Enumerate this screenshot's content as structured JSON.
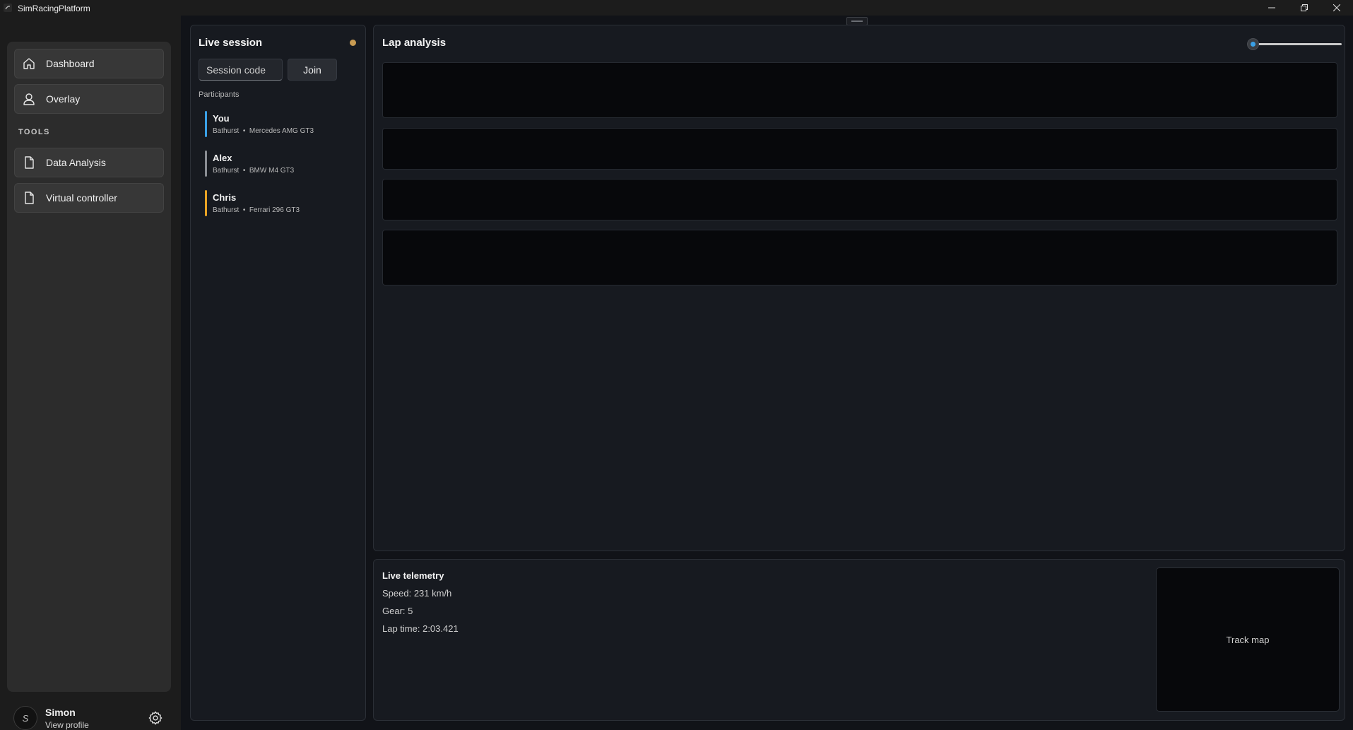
{
  "window": {
    "title": "SimRacingPlatform",
    "controls": [
      "minimize",
      "maximize",
      "close"
    ]
  },
  "sidebar": {
    "items": [
      {
        "label": "Dashboard",
        "icon": "home-icon"
      },
      {
        "label": "Overlay",
        "icon": "person-icon"
      }
    ],
    "section_title": "TOOLS",
    "tools": [
      {
        "label": "Data Analysis",
        "icon": "document-icon"
      },
      {
        "label": "Virtual controller",
        "icon": "document-icon"
      }
    ],
    "profile": {
      "initial": "S",
      "name": "Simon",
      "subtitle": "View profile"
    }
  },
  "live_session": {
    "title": "Live session",
    "status_color": "#c89b52",
    "code_placeholder": "Session code",
    "join_label": "Join",
    "participants_label": "Participants",
    "participants": [
      {
        "name": "You",
        "track": "Bathurst",
        "sep": "•",
        "car": "Mercedes AMG GT3",
        "color": "#3aa0e6"
      },
      {
        "name": "Alex",
        "track": "Bathurst",
        "sep": "•",
        "car": "BMW M4 GT3",
        "color": "#8a8d93"
      },
      {
        "name": "Chris",
        "track": "Bathurst",
        "sep": "•",
        "car": "Ferrari 296 GT3",
        "color": "#e9a324"
      }
    ]
  },
  "lap_analysis": {
    "title": "Lap analysis",
    "slider_value": 0,
    "accent": "#3aa0e6"
  },
  "telemetry": {
    "title": "Live telemetry",
    "speed": "Speed: 231 km/h",
    "gear": "Gear: 5",
    "lap_time": "Lap time: 2:03.421",
    "track_map_label": "Track map"
  }
}
